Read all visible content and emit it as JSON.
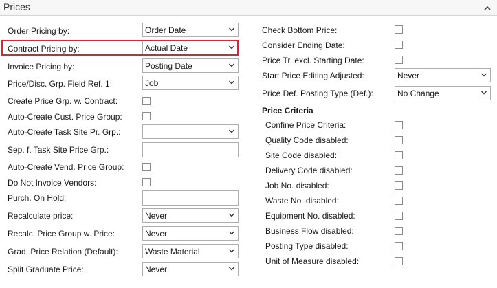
{
  "header": {
    "title": "Prices"
  },
  "left": {
    "order_pricing": {
      "label": "Order Pricing by:",
      "value": "Order Date"
    },
    "contract_pricing": {
      "label": "Contract Pricing by:",
      "value": "Actual Date"
    },
    "invoice_pricing": {
      "label": "Invoice Pricing by:",
      "value": "Posting Date"
    },
    "price_disc_field_ref": {
      "label": "Price/Disc. Grp. Field Ref. 1:",
      "value": "Job"
    },
    "create_price_grp_contract": {
      "label": "Create Price Grp. w. Contract:"
    },
    "auto_create_cust_price_group": {
      "label": "Auto-Create Cust. Price Group:"
    },
    "auto_create_task_site": {
      "label": "Auto-Create Task Site Pr. Grp.:",
      "value": ""
    },
    "sep_task_site": {
      "label": "Sep. f. Task Site Price Grp.:",
      "value": ""
    },
    "auto_create_vend_price_group": {
      "label": "Auto-Create Vend. Price Group:"
    },
    "do_not_invoice_vendors": {
      "label": "Do Not Invoice Vendors:"
    },
    "purch_on_hold": {
      "label": "Purch. On Hold:",
      "value": ""
    },
    "recalculate_price": {
      "label": "Recalculate price:",
      "value": "Never"
    },
    "recalc_price_group": {
      "label": "Recalc. Price Group w. Price:",
      "value": "Never"
    },
    "grad_price_relation": {
      "label": "Grad. Price Relation (Default):",
      "value": "Waste Material"
    },
    "split_graduate_price": {
      "label": "Split Graduate Price:",
      "value": "Never"
    }
  },
  "right": {
    "check_bottom_price": {
      "label": "Check Bottom Price:"
    },
    "consider_ending_date": {
      "label": "Consider Ending Date:"
    },
    "price_tr_excl_starting": {
      "label": "Price Tr. excl. Starting Date:"
    },
    "start_price_editing": {
      "label": "Start Price Editing Adjusted:",
      "value": "Never"
    },
    "price_def_posting_type": {
      "label": "Price Def. Posting Type (Def.):",
      "value": "No Change"
    },
    "criteria_title": "Price Criteria",
    "criteria": [
      "Confine Price Criteria:",
      "Quality Code disabled:",
      "Site Code disabled:",
      "Delivery Code disabled:",
      "Job No. disabled:",
      "Waste No. disabled:",
      "Equipment No. disabled:",
      "Business Flow disabled:",
      "Posting Type disabled:",
      "Unit of Measure disabled:"
    ]
  },
  "colors": {
    "highlight": "#d9252b",
    "border": "#abadb3"
  },
  "icons": {
    "collapse": "chevron-up-icon",
    "dropdown": "chevron-down-icon"
  }
}
